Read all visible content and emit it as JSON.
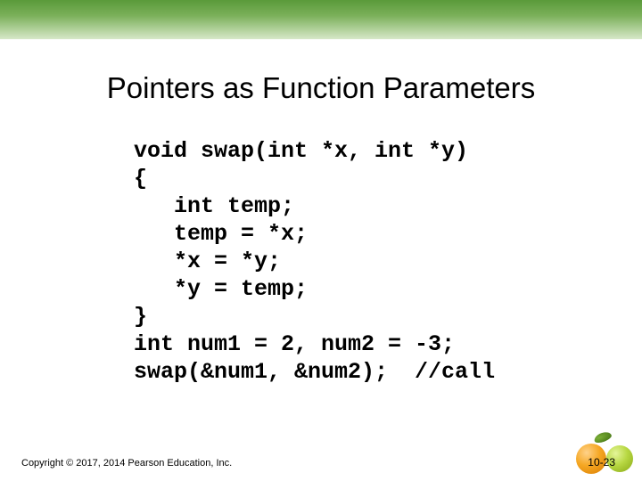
{
  "title": "Pointers as Function Parameters",
  "code": {
    "l1": "void swap(int *x, int *y)",
    "l2": "{",
    "l3": "   int temp;",
    "l4": "   temp = *x;",
    "l5": "   *x = *y;",
    "l6": "   *y = temp;",
    "l7": "}",
    "l8": "int num1 = 2, num2 = -3;",
    "l9": "swap(&num1, &num2);  //call"
  },
  "copyright": "Copyright © 2017, 2014 Pearson Education, Inc.",
  "slide_number": "10-23"
}
